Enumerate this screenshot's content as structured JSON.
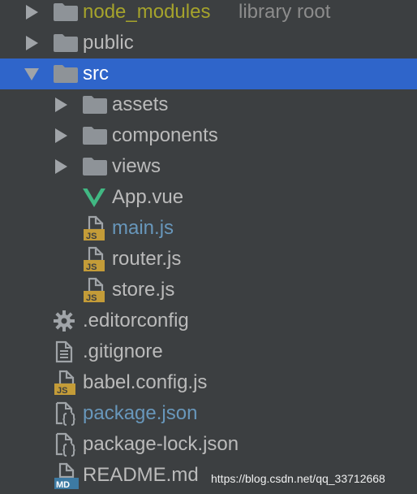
{
  "colors": {
    "background": "#3c3f41",
    "selection": "#2f65ca",
    "text_default": "#bbbbbb",
    "text_excluded": "#a5a32c",
    "text_modified": "#6897bb",
    "hint": "#8c8c8c",
    "folder": "#8e9398",
    "vue": "#41b883",
    "js_badge": "#c49c38",
    "md_badge": "#3d7aa3"
  },
  "tree": {
    "items": [
      {
        "name": "node_modules",
        "hint": "library root",
        "type": "folder",
        "state": "collapsed",
        "status": "excluded"
      },
      {
        "name": "public",
        "type": "folder",
        "state": "collapsed",
        "status": "normal"
      },
      {
        "name": "src",
        "type": "folder",
        "state": "expanded",
        "status": "normal",
        "selected": true
      },
      {
        "name": "assets",
        "type": "folder",
        "state": "collapsed",
        "status": "normal"
      },
      {
        "name": "components",
        "type": "folder",
        "state": "collapsed",
        "status": "normal"
      },
      {
        "name": "views",
        "type": "folder",
        "state": "collapsed",
        "status": "normal"
      },
      {
        "name": "App.vue",
        "type": "vue-file",
        "status": "normal"
      },
      {
        "name": "main.js",
        "type": "js-file",
        "status": "modified"
      },
      {
        "name": "router.js",
        "type": "js-file",
        "status": "normal"
      },
      {
        "name": "store.js",
        "type": "js-file",
        "status": "normal"
      },
      {
        "name": ".editorconfig",
        "type": "config-file",
        "status": "normal"
      },
      {
        "name": ".gitignore",
        "type": "text-file",
        "status": "normal"
      },
      {
        "name": "babel.config.js",
        "type": "js-file",
        "status": "normal"
      },
      {
        "name": "package.json",
        "type": "json-file",
        "status": "modified"
      },
      {
        "name": "package-lock.json",
        "type": "json-file",
        "status": "normal"
      },
      {
        "name": "README.md",
        "type": "md-file",
        "status": "normal"
      }
    ]
  },
  "icons": {
    "js_badge_text": "JS",
    "md_badge_text": "MD"
  },
  "watermark": "https://blog.csdn.net/qq_33712668"
}
